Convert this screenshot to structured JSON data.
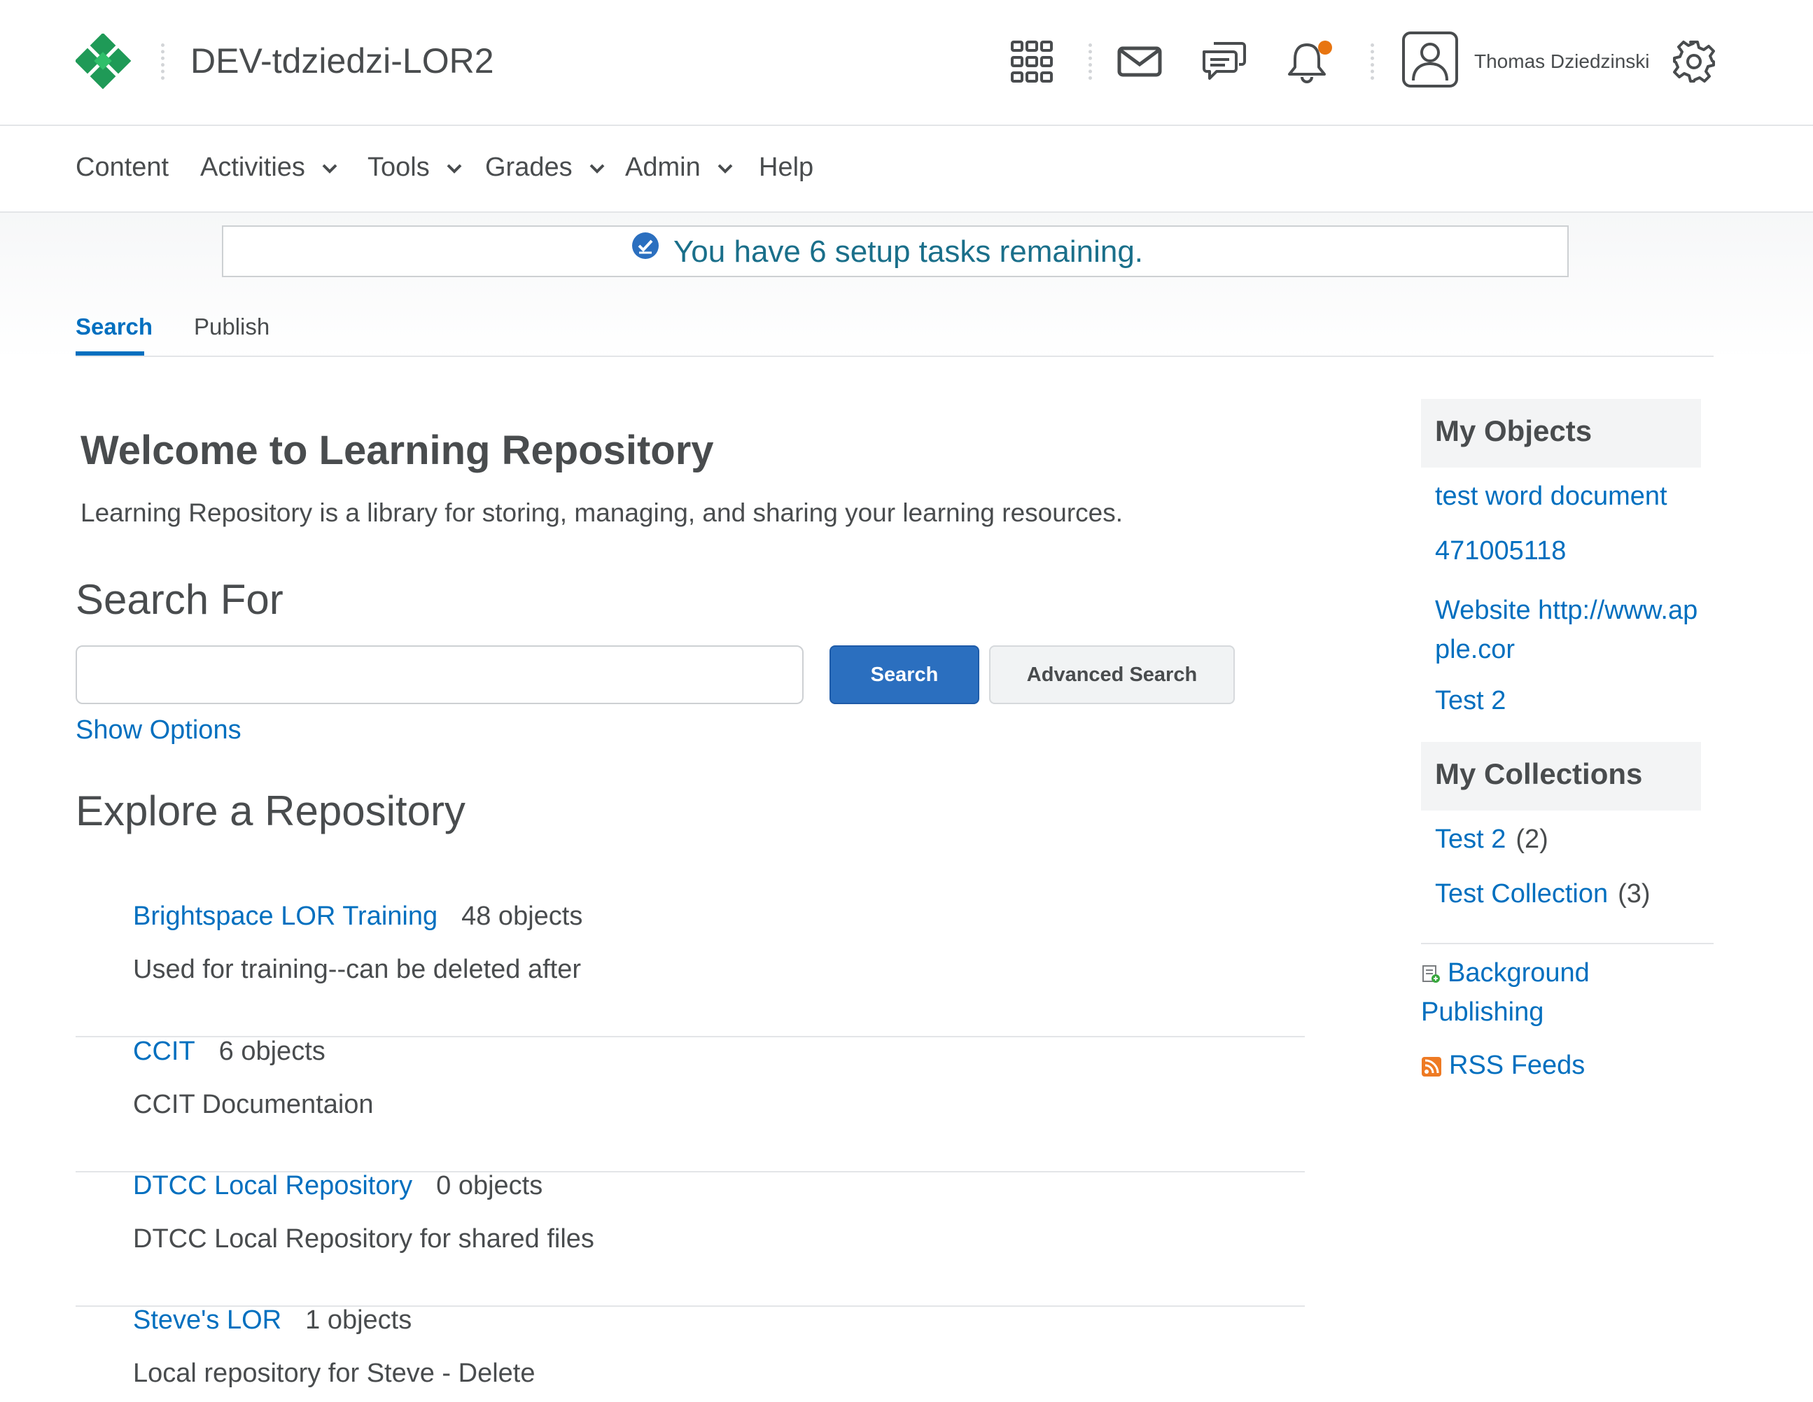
{
  "header": {
    "org_title": "DEV-tdziedzi-LOR2",
    "user_name": "Thomas Dziedzinski",
    "icons": [
      "waffle-grid-icon",
      "email-icon",
      "discussion-icon",
      "bell-icon",
      "avatar-icon",
      "gear-icon"
    ],
    "accent_color": "#e87511"
  },
  "nav": {
    "items": [
      {
        "label": "Content",
        "has_menu": false
      },
      {
        "label": "Activities",
        "has_menu": true
      },
      {
        "label": "Tools",
        "has_menu": true
      },
      {
        "label": "Grades",
        "has_menu": true
      },
      {
        "label": "Admin",
        "has_menu": true
      },
      {
        "label": "Help",
        "has_menu": false
      }
    ]
  },
  "setup_banner": {
    "text": "You have 6 setup tasks remaining."
  },
  "tabs": [
    {
      "label": "Search",
      "active": true
    },
    {
      "label": "Publish",
      "active": false
    }
  ],
  "welcome": {
    "title": "Welcome to Learning Repository",
    "description": "Learning Repository is a library for storing, managing, and sharing your learning resources."
  },
  "search": {
    "heading": "Search For",
    "input_value": "",
    "button_label": "Search",
    "advanced_label": "Advanced Search",
    "show_options": "Show Options"
  },
  "explore": {
    "heading": "Explore a Repository",
    "repos": [
      {
        "name": "Brightspace LOR Training",
        "count": "48 objects",
        "description": "Used for training--can be deleted after"
      },
      {
        "name": "CCIT",
        "count": "6 objects",
        "description": "CCIT Documentaion"
      },
      {
        "name": "DTCC Local Repository",
        "count": "0 objects",
        "description": "DTCC Local Repository for shared files"
      },
      {
        "name": "Steve's LOR",
        "count": "1 objects",
        "description": "Local repository for Steve - Delete"
      }
    ]
  },
  "sidebar": {
    "my_objects": {
      "title": "My Objects",
      "items": [
        "test word document",
        "471005118",
        "Website http://www.apple.cor",
        "Test 2"
      ]
    },
    "my_collections": {
      "title": "My Collections",
      "items": [
        {
          "name": "Test 2",
          "count": "(2)"
        },
        {
          "name": "Test Collection",
          "count": "(3)"
        }
      ]
    },
    "tools": {
      "background_publishing": "Background Publishing",
      "rss_feeds": "RSS Feeds"
    }
  },
  "colors": {
    "link": "#006fbf",
    "primary_button": "#2b6fbf",
    "brand_green": "#29a35a",
    "banner_text": "#1a6f8a"
  }
}
